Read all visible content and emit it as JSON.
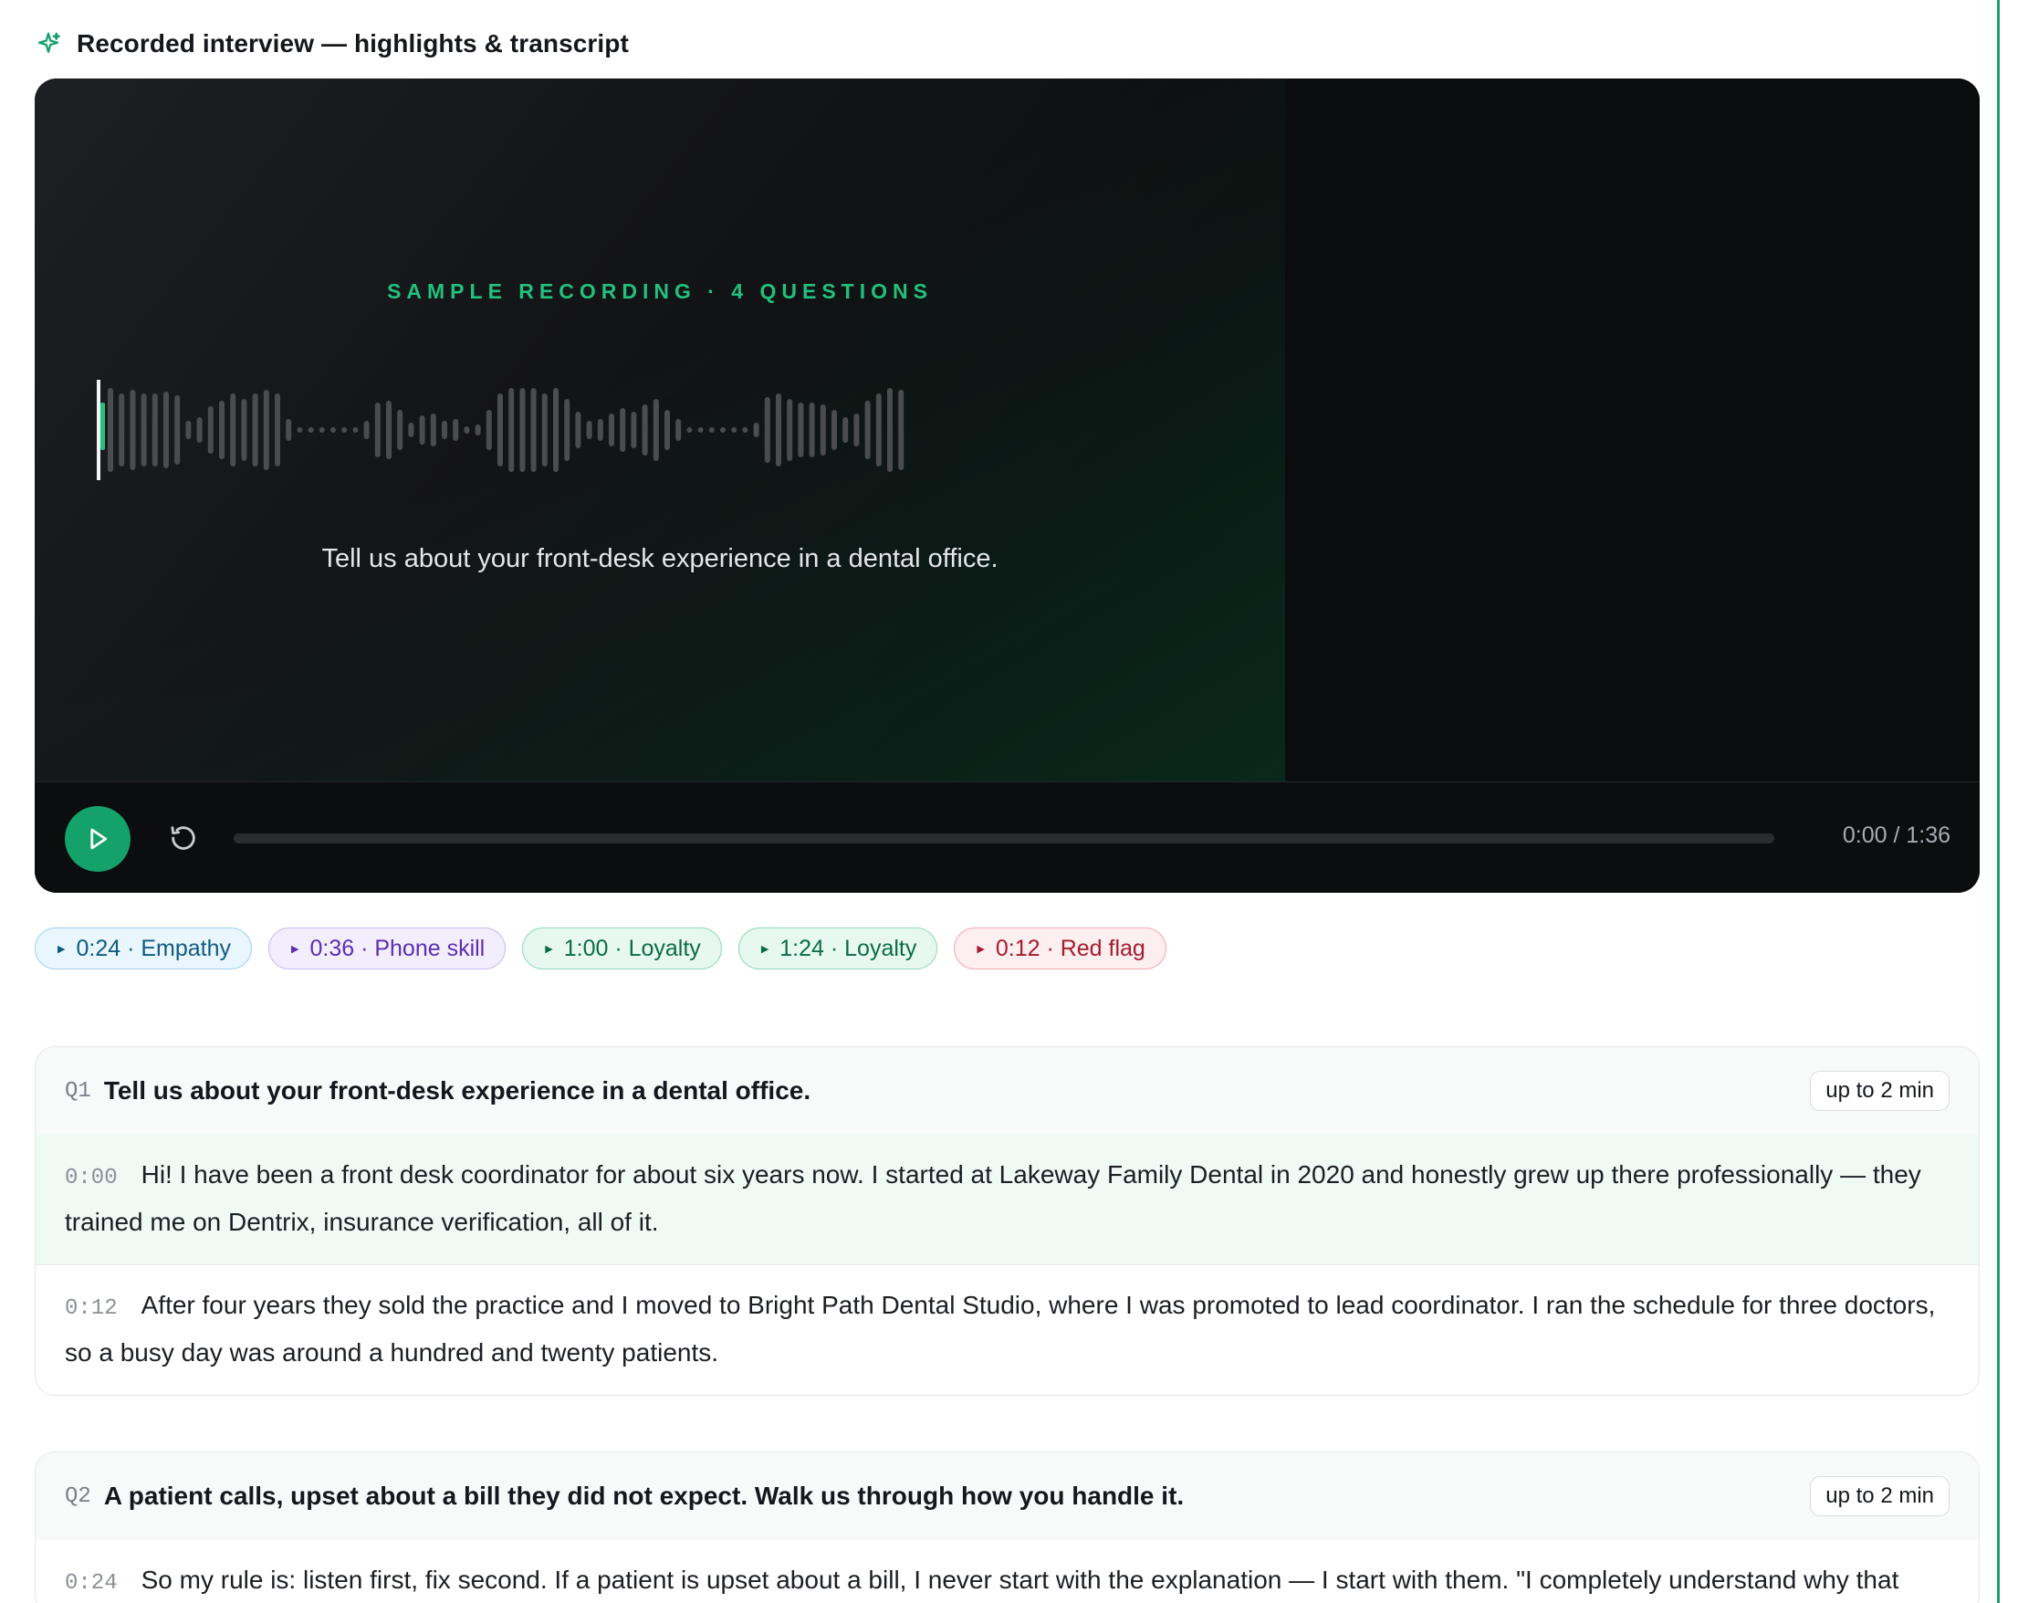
{
  "header": {
    "title": "Recorded interview — highlights & transcript",
    "accent": "#14a26a"
  },
  "player": {
    "overlay_label": "SAMPLE RECORDING · 4 QUESTIONS",
    "caption": "Tell us about your front-desk experience in a dental office.",
    "time": "0:00 / 1:36",
    "progress": 0,
    "play_icon": "play-icon",
    "replay_icon": "replay-icon"
  },
  "chips": [
    {
      "label": "0:24 · Empathy",
      "bg": "#eaf6fd",
      "border": "#9fd3f1",
      "color": "#0f5a82"
    },
    {
      "label": "0:36 · Phone skill",
      "bg": "#f3eefd",
      "border": "#cdb9f3",
      "color": "#5b2fb0"
    },
    {
      "label": "1:00 · Loyalty",
      "bg": "#e7f8f0",
      "border": "#8fdab8",
      "color": "#0d6b47"
    },
    {
      "label": "1:24 · Loyalty",
      "bg": "#e7f8f0",
      "border": "#8fdab8",
      "color": "#0d6b47"
    },
    {
      "label": "0:12 · Red flag",
      "bg": "#fdeef0",
      "border": "#f2aab4",
      "color": "#a31c2e"
    }
  ],
  "questions": [
    {
      "num": "Q1",
      "text": "Tell us about your front-desk experience in a dental office.",
      "limit": "up to 2 min",
      "segments": [
        {
          "ts": "0:00",
          "text": "Hi! I have been a front desk coordinator for about six years now. I started at Lakeway Family Dental in 2020 and honestly grew up there professionally — they trained me on Dentrix, insurance verification, all of it."
        },
        {
          "ts": "0:12",
          "text": "After four years they sold the practice and I moved to Bright Path Dental Studio, where I was promoted to lead coordinator. I ran the schedule for three doctors, so a busy day was around a hundred and twenty patients."
        }
      ]
    },
    {
      "num": "Q2",
      "text": "A patient calls, upset about a bill they did not expect. Walk us through how you handle it.",
      "limit": "up to 2 min",
      "segments": [
        {
          "ts": "0:24",
          "text": "So my rule is: listen first, fix second. If a patient is upset about a bill, I never start with the explanation — I start with them. \"I completely understand why that surprised you, let me pull it up right now.\""
        }
      ]
    }
  ]
}
